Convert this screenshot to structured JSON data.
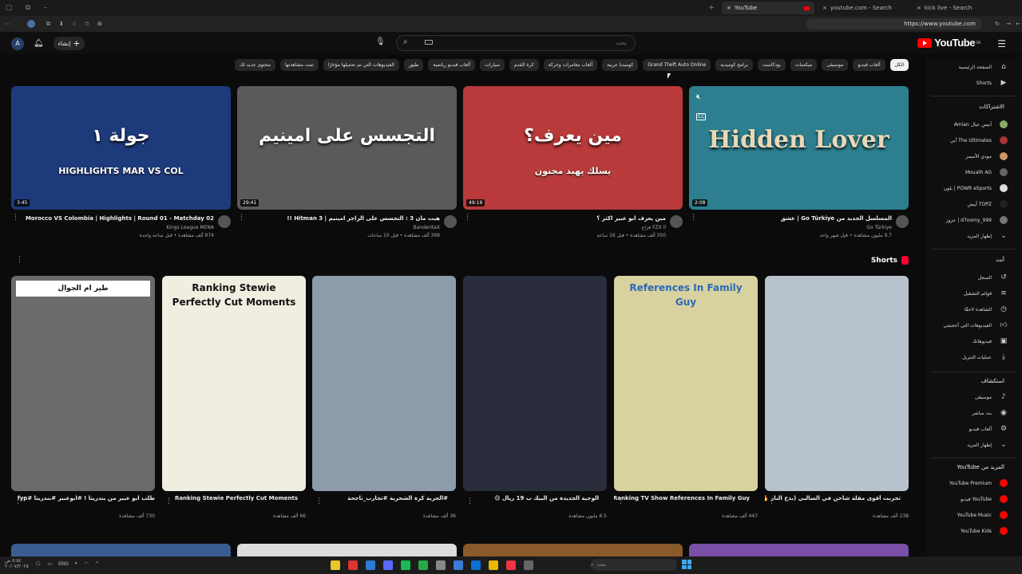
{
  "browser": {
    "tabs": [
      {
        "label": "YouTube",
        "active": true
      },
      {
        "label": "youtube.com - Search",
        "active": false
      },
      {
        "label": "kick live - Search",
        "active": false
      }
    ],
    "url": "https://www.youtube.com"
  },
  "header": {
    "logo_text": "YouTube",
    "logo_region": "SA",
    "search_placeholder": "بحث",
    "create_label": "إنشاء",
    "avatar_letter": "A"
  },
  "chips": [
    {
      "label": "الكل",
      "active": true
    },
    {
      "label": "ألعاب فيديو"
    },
    {
      "label": "موسيقى"
    },
    {
      "label": "ميكسات"
    },
    {
      "label": "بودكاست"
    },
    {
      "label": "برامج كوميدية"
    },
    {
      "label": "Grand Theft Auto Online"
    },
    {
      "label": "كوميديا عربية"
    },
    {
      "label": "ألعاب مغامرات وحركة"
    },
    {
      "label": "كرة القدم"
    },
    {
      "label": "سيارات"
    },
    {
      "label": "ألعاب فيديو رياضية"
    },
    {
      "label": "طيور"
    },
    {
      "label": "الفيديوهات التي تم تحميلها مؤخرًا"
    },
    {
      "label": "تمت مشاهدتها"
    },
    {
      "label": "محتوى جديد لك"
    }
  ],
  "sidebar": {
    "top_items": [
      {
        "label": "الصفحة الرئيسية",
        "icon": "home-icon"
      },
      {
        "label": "Shorts",
        "icon": "shorts-icon"
      }
    ],
    "subscriptions_header": "الاشتراكات",
    "subscriptions": [
      {
        "label": "آنيس عيال Amian",
        "color": "#8a6"
      },
      {
        "label": "The Ultimates أبي",
        "color": "#a33"
      },
      {
        "label": "مودي الأسمر",
        "color": "#c96"
      },
      {
        "label": "Mouath AG",
        "color": "#666"
      },
      {
        "label": "POWR eSports | بلون",
        "color": "#ddd"
      },
      {
        "label": "TOPZ أبيض",
        "color": "#222"
      },
      {
        "label": "d7oomy_999 | عزوز",
        "color": "#777"
      }
    ],
    "show_more": "إظهار المزيد",
    "you_header": "أنت",
    "you_items": [
      {
        "label": "السجل",
        "icon": "history-icon"
      },
      {
        "label": "قوائم التشغيل",
        "icon": "playlist-icon"
      },
      {
        "label": "الشاهدة لاحقًا",
        "icon": "clock-icon"
      },
      {
        "label": "الفيديوهات التي أعجبتني",
        "icon": "like-icon"
      },
      {
        "label": "فيديوهاتك",
        "icon": "video-icon"
      },
      {
        "label": "عمليات التنزيل",
        "icon": "download-icon"
      }
    ],
    "explore_header": "استكشاف",
    "explore_items": [
      {
        "label": "موسيقى",
        "icon": "music-icon"
      },
      {
        "label": "بث مباشر",
        "icon": "live-icon"
      },
      {
        "label": "ألعاب فيديو",
        "icon": "gaming-icon"
      },
      {
        "label": "إظهار المزيد",
        "icon": "chevron-down-icon"
      }
    ],
    "more_header": "المزيد من YouTube",
    "more_items": [
      {
        "label": "YouTube Premium"
      },
      {
        "label": "YouTube فيديو"
      },
      {
        "label": "YouTube Music"
      },
      {
        "label": "YouTube Kids"
      }
    ]
  },
  "videos": [
    {
      "title": "Morocco VS Colombia | Highlights | Round 01 - Matchday 02",
      "channel": "Kings League MENA",
      "meta": "974 ألف مشاهدة • قبل ساعة واحدة",
      "duration": "3:45",
      "thumb_text": "جولة ١",
      "thumb_sub": "HIGHLIGHTS  MAR VS COL",
      "bg": "#1d3a7a"
    },
    {
      "title": "هيت مان 3 : التجسس على الراجر امينيم | Hitman 3 !!",
      "channel": "BanderitaX",
      "meta": "399 ألف مشاهدة • قبل 10 ساعات",
      "duration": "29:41",
      "thumb_text": "التجسس على امينيم",
      "thumb_sub": "",
      "bg": "#5a5a5a"
    },
    {
      "title": "مين يعرف ابو عبير اكثر ؟",
      "channel": "FZX ll فزاع",
      "meta": "350 ألف مشاهدة • قبل 16 ساعة",
      "duration": "49:16",
      "thumb_text": "مين يعرف؟",
      "thumb_sub": "يسلك  يهبد  مجنون",
      "bg": "#b83a3a"
    },
    {
      "title": "المسلسل الجديد من Go Türkiye | عشق",
      "channel": "Go Türkiye",
      "meta": "9.7 مليون مشاهدة • قبل شهر واحد",
      "duration": "2:08",
      "thumb_text": "Hidden Lover",
      "thumb_sub": "",
      "bg": "#2d7f8f"
    }
  ],
  "shorts_header": "Shorts",
  "shorts": [
    {
      "title": "طلب ابو عبير من بندريتا ! #ابوعبير #بندريتا #fyp",
      "meta": "730 ألف مشاهدة",
      "overlay": "طير ام الجوال",
      "bg": "#6b6b6b"
    },
    {
      "title": "Ranking Stewie Perfectly Cut Moments",
      "meta": "66 ألف مشاهدة",
      "overlay": "Ranking Stewie Perfectly Cut Moments",
      "bg": "#f0eee0"
    },
    {
      "title": "#الجرية كرة الشحرية #تجارب_ناجحة",
      "meta": "36 ألف مشاهدة",
      "overlay": "",
      "bg": "#8e9bab"
    },
    {
      "title": "الوجبة الجديدة من البيك ب 19 ريال 😋",
      "meta": "6.5 مليون مشاهدة",
      "overlay": "",
      "bg": "#2a2d3c"
    },
    {
      "title": "Ranking TV Show References In Family Guy",
      "meta": "447 ألف مشاهدة",
      "overlay": "References In Family Guy",
      "bg": "#d8d1a0"
    },
    {
      "title": "تجربت أقوى مقلة شاحن في السالبي (بدخ النار 🔥) والنتيجة",
      "meta": "238 ألف مشاهدة",
      "overlay": "",
      "bg": "#b7c2cc"
    }
  ],
  "taskbar": {
    "search_placeholder": "بحث",
    "lang": "ENG",
    "time": "٥:٥٤ ص",
    "date": "٢٠/٠٧/٢٠٢٥"
  }
}
